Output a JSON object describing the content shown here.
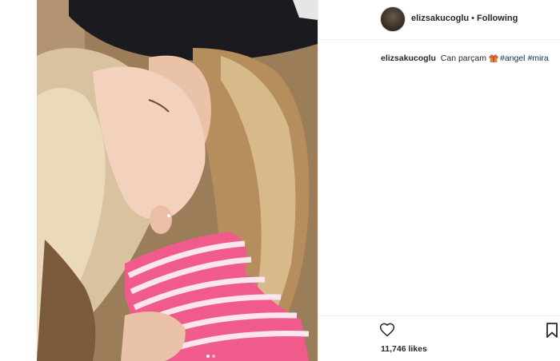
{
  "post": {
    "username": "elizsakucoglu",
    "separator": "•",
    "follow_status": "Following",
    "caption": {
      "username": "elizsakucoglu",
      "text": "Can parçam",
      "emoji_icon": "gift-box-icon",
      "hashtags": [
        "#angel",
        "#mira"
      ]
    },
    "likes_text": "11,746 likes",
    "carousel": {
      "count": 2,
      "active_index": 0
    }
  },
  "photo": {
    "description_icon": "photo",
    "palette": {
      "cap": "#1b1b1f",
      "hair_light": "#d8c2a0",
      "hair_dark": "#8a6a45",
      "skin": "#f0cdb6",
      "stripe_pink": "#f05b8c",
      "stripe_white": "#fbe6ee"
    }
  },
  "colors": {
    "tag_blue": "#003569",
    "text_dark": "#262626",
    "border": "#efefef"
  }
}
